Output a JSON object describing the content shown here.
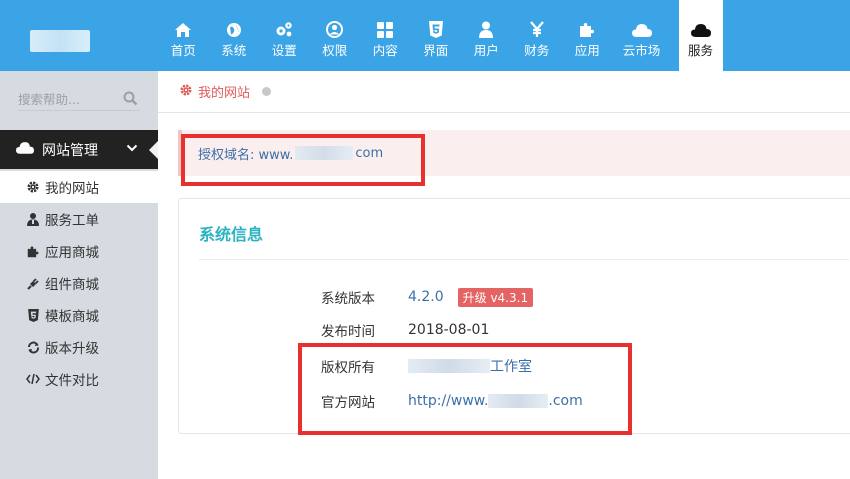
{
  "nav": {
    "items": [
      {
        "label": "首页",
        "icon": "home-icon"
      },
      {
        "label": "系统",
        "icon": "globe-icon"
      },
      {
        "label": "设置",
        "icon": "cogs-icon"
      },
      {
        "label": "权限",
        "icon": "user-circle-icon"
      },
      {
        "label": "内容",
        "icon": "grid-icon"
      },
      {
        "label": "界面",
        "icon": "html5-icon"
      },
      {
        "label": "用户",
        "icon": "user-icon"
      },
      {
        "label": "财务",
        "icon": "yen-icon"
      },
      {
        "label": "应用",
        "icon": "puzzle-icon"
      },
      {
        "label": "云市场",
        "icon": "cloud-icon"
      },
      {
        "label": "服务",
        "icon": "cloud-icon",
        "active": true
      }
    ]
  },
  "sidebar": {
    "search_placeholder": "搜索帮助...",
    "section_title": "网站管理",
    "items": [
      {
        "label": "我的网站",
        "icon": "gear-icon",
        "active": true
      },
      {
        "label": "服务工单",
        "icon": "support-user-icon"
      },
      {
        "label": "应用商城",
        "icon": "puzzle-icon"
      },
      {
        "label": "组件商城",
        "icon": "plug-icon"
      },
      {
        "label": "模板商城",
        "icon": "html5-icon"
      },
      {
        "label": "版本升级",
        "icon": "refresh-icon"
      },
      {
        "label": "文件对比",
        "icon": "code-icon"
      }
    ]
  },
  "breadcrumb": {
    "label": "我的网站"
  },
  "license": {
    "prefix": "授权域名: www.",
    "suffix": "com"
  },
  "system_info": {
    "title": "系统信息",
    "version_label": "系统版本",
    "version_value": "4.2.0",
    "upgrade_badge": "升级 v4.3.1",
    "release_label": "发布时间",
    "release_value": "2018-08-01",
    "copyright_label": "版权所有",
    "copyright_suffix": "工作室",
    "website_label": "官方网站",
    "website_prefix": "http://www.",
    "website_suffix": ".com"
  },
  "colors": {
    "topbar": "#3ba4e6",
    "sidebar": "#d5dbe0",
    "section_head": "#222222",
    "panel_title": "#2bb3c0",
    "badge": "#e46464",
    "highlight_box": "#e8312f"
  }
}
